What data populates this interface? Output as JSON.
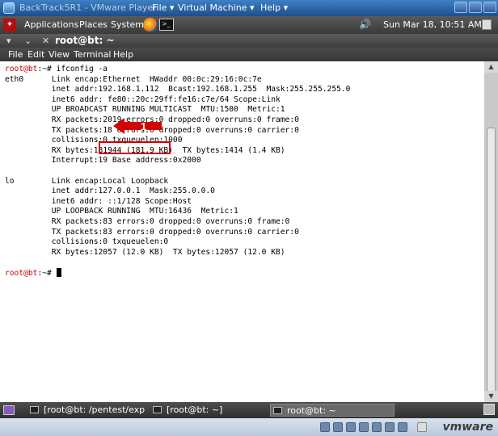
{
  "vmware": {
    "title": "BackTrack5R1 - VMware Player",
    "menus": [
      "File ▾",
      "Virtual Machine ▾",
      "Help ▾"
    ],
    "brand": "vmware"
  },
  "panel": {
    "applications": "Applications",
    "places": "Places",
    "system": "System",
    "datetime": "Sun Mar 18, 10:51 AM"
  },
  "terminal": {
    "title": "root@bt: ~",
    "menu": [
      "File",
      "Edit",
      "View",
      "Terminal",
      "Help"
    ],
    "lines": [
      {
        "prompt": "root@bt",
        "path": ":~# ",
        "text": "ifconfig -a"
      },
      {
        "prompt": "",
        "path": "",
        "text": "eth0      Link encap:Ethernet  HWaddr 00:0c:29:16:0c:7e"
      },
      {
        "prompt": "",
        "path": "",
        "text": "          inet addr:192.168.1.112  Bcast:192.168.1.255  Mask:255.255.255.0"
      },
      {
        "prompt": "",
        "path": "",
        "text": "          inet6 addr: fe80::20c:29ff:fe16:c7e/64 Scope:Link"
      },
      {
        "prompt": "",
        "path": "",
        "text": "          UP BROADCAST RUNNING MULTICAST  MTU:1500  Metric:1"
      },
      {
        "prompt": "",
        "path": "",
        "text": "          RX packets:2019 errors:0 dropped:0 overruns:0 frame:0"
      },
      {
        "prompt": "",
        "path": "",
        "text": "          TX packets:18 errors:0 dropped:0 overruns:0 carrier:0"
      },
      {
        "prompt": "",
        "path": "",
        "text": "          collisions:0 txqueuelen:1000"
      },
      {
        "prompt": "",
        "path": "",
        "text": "          RX bytes:181944 (181.9 KB)  TX bytes:1414 (1.4 KB)"
      },
      {
        "prompt": "",
        "path": "",
        "text": "          Interrupt:19 Base address:0x2000"
      },
      {
        "prompt": "",
        "path": "",
        "text": ""
      },
      {
        "prompt": "",
        "path": "",
        "text": "lo        Link encap:Local Loopback"
      },
      {
        "prompt": "",
        "path": "",
        "text": "          inet addr:127.0.0.1  Mask:255.0.0.0"
      },
      {
        "prompt": "",
        "path": "",
        "text": "          inet6 addr: ::1/128 Scope:Host"
      },
      {
        "prompt": "",
        "path": "",
        "text": "          UP LOOPBACK RUNNING  MTU:16436  Metric:1"
      },
      {
        "prompt": "",
        "path": "",
        "text": "          RX packets:83 errors:0 dropped:0 overruns:0 frame:0"
      },
      {
        "prompt": "",
        "path": "",
        "text": "          TX packets:83 errors:0 dropped:0 overruns:0 carrier:0"
      },
      {
        "prompt": "",
        "path": "",
        "text": "          collisions:0 txqueuelen:0"
      },
      {
        "prompt": "",
        "path": "",
        "text": "          RX bytes:12057 (12.0 KB)  TX bytes:12057 (12.0 KB)"
      },
      {
        "prompt": "",
        "path": "",
        "text": ""
      },
      {
        "prompt": "root@bt",
        "path": ":~# ",
        "text": ""
      }
    ],
    "annotation_number": "1",
    "highlight_color": "#d40000"
  },
  "taskbar": {
    "tasks": [
      "[root@bt: /pentest/exp...",
      "[root@bt: ~]",
      "root@bt: ~"
    ]
  }
}
